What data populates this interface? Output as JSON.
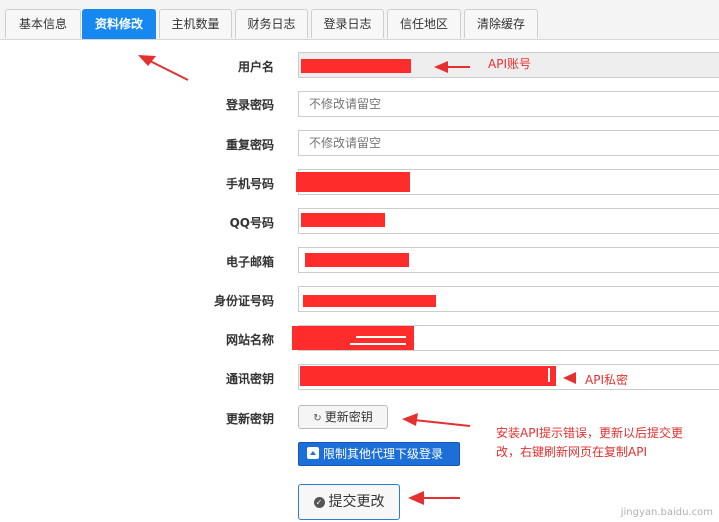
{
  "tabs": [
    {
      "label": "基本信息"
    },
    {
      "label": "资料修改"
    },
    {
      "label": "主机数量"
    },
    {
      "label": "财务日志"
    },
    {
      "label": "登录日志"
    },
    {
      "label": "信任地区"
    },
    {
      "label": "清除缓存"
    }
  ],
  "form": {
    "username_label": "用户名",
    "password_label": "登录密码",
    "password_placeholder": "不修改请留空",
    "repeat_password_label": "重复密码",
    "repeat_password_placeholder": "不修改请留空",
    "phone_label": "手机号码",
    "qq_label": "QQ号码",
    "email_label": "电子邮箱",
    "idcard_label": "身份证号码",
    "site_name_label": "网站名称",
    "comm_key_label": "通讯密钥",
    "update_key_label": "更新密钥"
  },
  "buttons": {
    "update_key": "更新密钥",
    "limit_agents": "限制其他代理下级登录",
    "submit": "提交更改"
  },
  "annotations": {
    "api_account": "API账号",
    "api_secret": "API私密",
    "note_line1": "安装API提示错误，更新以后提交更",
    "note_line2": "改，右键刷新网页在复制API"
  },
  "watermark": "jingyan.baidu.com",
  "colors": {
    "tab_active": "#1688f0",
    "redaction": "#ff2c2c",
    "annotation": "#e53030",
    "primary_button": "#1c6fd9"
  }
}
